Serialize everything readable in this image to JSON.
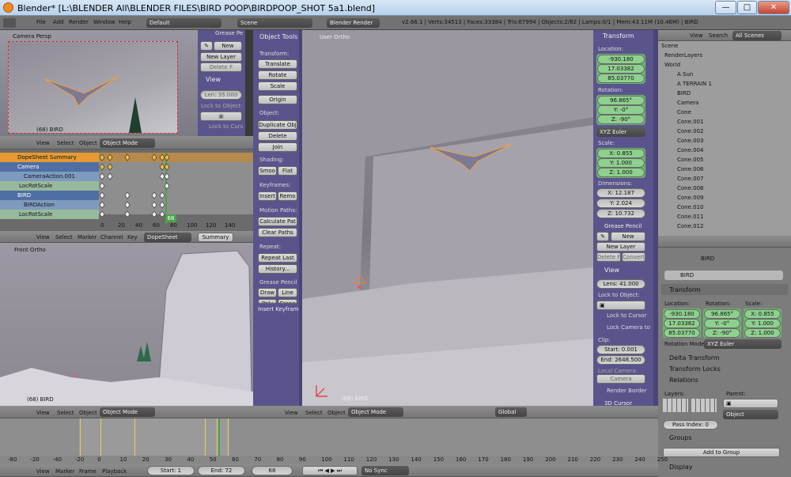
{
  "window": {
    "title": "Blender* [L:\\BLENDER All\\BLENDER FILES\\BIRD POOP\\BIRDPOOP_SHOT 5a1.blend]",
    "min": "—",
    "max": "□",
    "close": "✕"
  },
  "infobar": {
    "menus": [
      "File",
      "Add",
      "Render",
      "Window",
      "Help"
    ],
    "layout": "Default",
    "scene": "Scene",
    "engine": "Blender Render",
    "stats": "v2.66.1 | Verts:34513 | Faces:33384 | Tris:67994 | Objects:2/82 | Lamps:0/1 | Mem:43.11M (10.46M) | BIRD"
  },
  "cam_view": {
    "label": "Camera Persp",
    "frame": "(68) BIRD"
  },
  "cam_npanel": {
    "gp": "Grease Pe",
    "new": "New",
    "new_layer": "New Layer",
    "delete": "Delete F",
    "convert": "Convert",
    "view": "View",
    "lens": "Len: 35.000",
    "lock": "Lock to Object:",
    "lock_cursor": "Lock to Curs"
  },
  "view3d_header1": {
    "menus": [
      "View",
      "Select",
      "Object"
    ],
    "mode": "Object Mode"
  },
  "dopesheet": {
    "rows": [
      "DopeSheet Summary",
      "Camera",
      "CameraAction.001",
      "LocRotScale",
      "BIRD",
      "BIRDAction",
      "LocRotScale"
    ],
    "ticks": [
      "0",
      "20",
      "40",
      "60",
      "80",
      "100",
      "120",
      "140"
    ],
    "current": "68",
    "menus": [
      "View",
      "Select",
      "Marker",
      "Channel",
      "Key"
    ],
    "mode": "DopeSheet",
    "summary": "Summary"
  },
  "front_view": {
    "label": "Front Ortho",
    "frame": "(68) BIRD"
  },
  "tools": {
    "title": "Object Tools",
    "sections": {
      "transform": "Transform:",
      "object": "Object:",
      "shading": "Shading:",
      "keyframes": "Keyframes:",
      "motion": "Motion Paths:",
      "repeat": "Repeat:",
      "gp": "Grease Pencil"
    },
    "translate": "Translate",
    "rotate": "Rotate",
    "scale": "Scale",
    "origin": "Origin",
    "duplicate": "Duplicate Obj",
    "delete": "Delete",
    "join": "Join",
    "smooth": "Smoo",
    "flat": "Flat",
    "insert": "Insert",
    "remove": "Remo",
    "calc": "Calculate Pat",
    "clear": "Clear Paths",
    "repeat_last": "Repeat Last",
    "history": "History...",
    "draw": "Draw",
    "line": "Line",
    "poly": "Poly",
    "erase": "Erase",
    "insert_kf": "Insert Keyframe"
  },
  "main_view": {
    "label": "User Ortho",
    "frame": "(68) BIRD",
    "menus": [
      "View",
      "Select",
      "Object"
    ],
    "mode": "Object Mode",
    "orient": "Global"
  },
  "npanel": {
    "transform": "Transform",
    "location": "Location:",
    "loc": [
      "-930.180",
      "17.03382",
      "85.03770"
    ],
    "rotation": "Rotation:",
    "rot": [
      "96.865°",
      "Y: -0°",
      "Z: -90°"
    ],
    "euler": "XYZ Euler",
    "scale": "Scale:",
    "scl": [
      "X: 0.855",
      "Y: 1.000",
      "Z: 1.000"
    ],
    "dimensions": "Dimensions:",
    "dim": [
      "X: 12.187",
      "Y: 2.024",
      "Z: 10.732"
    ],
    "gp": "Grease Pencil",
    "new": "New",
    "new_layer": "New Layer",
    "delete": "Delete Fra",
    "convert": "Convert",
    "view": "View",
    "lens": "Lens: 41.000",
    "lock": "Lock to Object:",
    "lock_cursor": "Lock to Cursor",
    "lock_camera": "Lock Camera to",
    "clip": "Clip:",
    "start": "Start: 0.001",
    "end": "End: 2648.500",
    "local_camera": "Local Camera:",
    "camera": "Camera",
    "render_border": "Render Border",
    "cursor3d": "3D Cursor"
  },
  "outliner": {
    "menus": [
      "View",
      "Search"
    ],
    "filter": "All Scenes",
    "rows": [
      "Scene",
      "RenderLayers",
      "World",
      "A Sun",
      "A TERRAIN 1",
      "BIRD",
      "Camera",
      "Cone",
      "Cone.001",
      "Cone.002",
      "Cone.003",
      "Cone.004",
      "Cone.005",
      "Cone.006",
      "Cone.007",
      "Cone.008",
      "Cone.009",
      "Cone.010",
      "Cone.011",
      "Cone.012"
    ]
  },
  "properties": {
    "object": "BIRD",
    "name": "BIRD",
    "transform": "Transform",
    "location": "Location:",
    "rotation": "Rotation:",
    "scale": "Scale:",
    "loc": [
      "-930.180",
      "17.03382",
      "85.03770"
    ],
    "rot": [
      "96.865°",
      "Y: -0°",
      "Z: -90°"
    ],
    "scl": [
      "X: 0.855",
      "Y: 1.000",
      "Z: 1.000"
    ],
    "rotmode_label": "Rotation Mode:",
    "rotmode": "XYZ Euler",
    "delta": "Delta Transform",
    "locks": "Transform Locks",
    "relations": "Relations",
    "layers": "Layers:",
    "parent": "Parent:",
    "parent_val": "Object",
    "pass": "Pass Index: 0",
    "groups": "Groups",
    "add_group": "Add to Group",
    "display": "Display"
  },
  "timeline": {
    "ticks": [
      "-80",
      "-20",
      "-40",
      "-20",
      "0",
      "10",
      "20",
      "30",
      "40",
      "50",
      "60",
      "70",
      "80",
      "90",
      "100",
      "110",
      "120",
      "130",
      "140",
      "150",
      "160",
      "170",
      "180",
      "190",
      "200",
      "210",
      "220",
      "230",
      "240",
      "250"
    ],
    "menus": [
      "View",
      "Marker",
      "Frame",
      "Playback"
    ],
    "start": "Start: 1",
    "end": "End: 72",
    "current": "68",
    "sync": "No Sync"
  }
}
